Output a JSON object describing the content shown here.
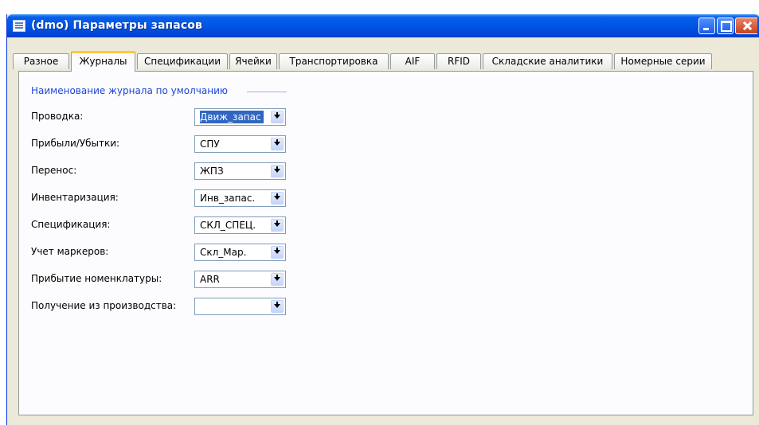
{
  "window": {
    "title": "(dmo) Параметры запасов"
  },
  "tabs": [
    {
      "label": "Разное",
      "active": false
    },
    {
      "label": "Журналы",
      "active": true
    },
    {
      "label": "Спецификации",
      "active": false
    },
    {
      "label": "Ячейки",
      "active": false
    },
    {
      "label": "Транспортировка",
      "active": false
    },
    {
      "label": "AIF",
      "active": false
    },
    {
      "label": "RFID",
      "active": false
    },
    {
      "label": "Складские аналитики",
      "active": false
    },
    {
      "label": "Номерные серии",
      "active": false
    }
  ],
  "group": {
    "title": "Наименование журнала по умолчанию"
  },
  "fields": [
    {
      "label": "Проводка:",
      "value": "Движ_запас"
    },
    {
      "label": "Прибыли/Убытки:",
      "value": "СПУ"
    },
    {
      "label": "Перенос:",
      "value": "ЖПЗ"
    },
    {
      "label": "Инвентаризация:",
      "value": "Инв_запас."
    },
    {
      "label": "Спецификация:",
      "value": "СКЛ_СПЕЦ."
    },
    {
      "label": "Учет маркеров:",
      "value": "Скл_Мар."
    },
    {
      "label": "Прибытие номенклатуры:",
      "value": "ARR"
    },
    {
      "label": "Получение из производства:",
      "value": ""
    }
  ],
  "colors": {
    "titlebar": "#0055e5",
    "group_title": "#1d46d6",
    "selection": "#3066c2",
    "active_tab_accent": "#ffc83c"
  }
}
